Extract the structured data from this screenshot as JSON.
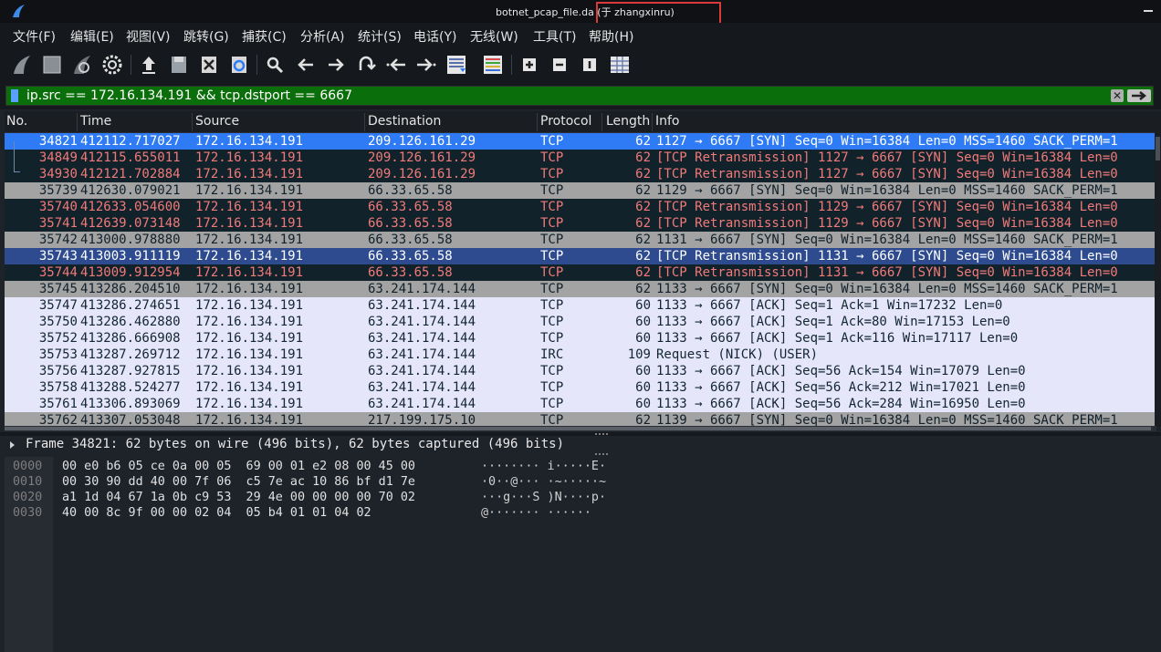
{
  "window": {
    "title": "botnet_pcap_file.da (于 zhangxinru)"
  },
  "menu": [
    "文件(F)",
    "编辑(E)",
    "视图(V)",
    "跳转(G)",
    "捕获(C)",
    "分析(A)",
    "统计(S)",
    "电话(Y)",
    "无线(W)",
    "工具(T)",
    "帮助(H)"
  ],
  "toolbar": {
    "icons": [
      "shark-fin-icon",
      "stop-icon",
      "restart-icon",
      "options-gear-icon",
      "open-file-icon",
      "save-file-icon",
      "close-file-icon",
      "reload-icon",
      "search-icon",
      "back-arrow-icon",
      "forward-arrow-icon",
      "jump-icon",
      "first-packet-icon",
      "last-packet-icon",
      "autoscroll-icon",
      "colorize-icon",
      "zoom-in-icon",
      "zoom-out-icon",
      "normal-size-icon",
      "resize-columns-icon"
    ]
  },
  "filter": {
    "value": "ip.src == 172.16.134.191 && tcp.dstport == 6667"
  },
  "columns": [
    "No.",
    "Time",
    "Source",
    "Destination",
    "Protocol",
    "Length",
    "Info"
  ],
  "packets": [
    {
      "no": "34821",
      "time": "412112.717027",
      "src": "172.16.134.191",
      "dst": "209.126.161.29",
      "proto": "TCP",
      "len": "62",
      "info": "1127 → 6667 [SYN] Seq=0 Win=16384 Len=0 MSS=1460 SACK_PERM=1",
      "style": "sel"
    },
    {
      "no": "34849",
      "time": "412115.655011",
      "src": "172.16.134.191",
      "dst": "209.126.161.29",
      "proto": "TCP",
      "len": "62",
      "info": "[TCP Retransmission] 1127 → 6667 [SYN] Seq=0 Win=16384 Len=0",
      "style": "dark"
    },
    {
      "no": "34930",
      "time": "412121.702884",
      "src": "172.16.134.191",
      "dst": "209.126.161.29",
      "proto": "TCP",
      "len": "62",
      "info": "[TCP Retransmission] 1127 → 6667 [SYN] Seq=0 Win=16384 Len=0",
      "style": "dark"
    },
    {
      "no": "35739",
      "time": "412630.079021",
      "src": "172.16.134.191",
      "dst": "66.33.65.58",
      "proto": "TCP",
      "len": "62",
      "info": "1129 → 6667 [SYN] Seq=0 Win=16384 Len=0 MSS=1460 SACK_PERM=1",
      "style": "gray"
    },
    {
      "no": "35740",
      "time": "412633.054600",
      "src": "172.16.134.191",
      "dst": "66.33.65.58",
      "proto": "TCP",
      "len": "62",
      "info": "[TCP Retransmission] 1129 → 6667 [SYN] Seq=0 Win=16384 Len=0",
      "style": "dark"
    },
    {
      "no": "35741",
      "time": "412639.073148",
      "src": "172.16.134.191",
      "dst": "66.33.65.58",
      "proto": "TCP",
      "len": "62",
      "info": "[TCP Retransmission] 1129 → 6667 [SYN] Seq=0 Win=16384 Len=0",
      "style": "dark"
    },
    {
      "no": "35742",
      "time": "413000.978880",
      "src": "172.16.134.191",
      "dst": "66.33.65.58",
      "proto": "TCP",
      "len": "62",
      "info": "1131 → 6667 [SYN] Seq=0 Win=16384 Len=0 MSS=1460 SACK_PERM=1",
      "style": "gray"
    },
    {
      "no": "35743",
      "time": "413003.911119",
      "src": "172.16.134.191",
      "dst": "66.33.65.58",
      "proto": "TCP",
      "len": "62",
      "info": "[TCP Retransmission] 1131 → 6667 [SYN] Seq=0 Win=16384 Len=0",
      "style": "selblue"
    },
    {
      "no": "35744",
      "time": "413009.912954",
      "src": "172.16.134.191",
      "dst": "66.33.65.58",
      "proto": "TCP",
      "len": "62",
      "info": "[TCP Retransmission] 1131 → 6667 [SYN] Seq=0 Win=16384 Len=0",
      "style": "dark"
    },
    {
      "no": "35745",
      "time": "413286.204510",
      "src": "172.16.134.191",
      "dst": "63.241.174.144",
      "proto": "TCP",
      "len": "62",
      "info": "1133 → 6667 [SYN] Seq=0 Win=16384 Len=0 MSS=1460 SACK_PERM=1",
      "style": "gray"
    },
    {
      "no": "35747",
      "time": "413286.274651",
      "src": "172.16.134.191",
      "dst": "63.241.174.144",
      "proto": "TCP",
      "len": "60",
      "info": "1133 → 6667 [ACK] Seq=1 Ack=1 Win=17232 Len=0",
      "style": "light"
    },
    {
      "no": "35750",
      "time": "413286.462880",
      "src": "172.16.134.191",
      "dst": "63.241.174.144",
      "proto": "TCP",
      "len": "60",
      "info": "1133 → 6667 [ACK] Seq=1 Ack=80 Win=17153 Len=0",
      "style": "light"
    },
    {
      "no": "35752",
      "time": "413286.666908",
      "src": "172.16.134.191",
      "dst": "63.241.174.144",
      "proto": "TCP",
      "len": "60",
      "info": "1133 → 6667 [ACK] Seq=1 Ack=116 Win=17117 Len=0",
      "style": "light"
    },
    {
      "no": "35753",
      "time": "413287.269712",
      "src": "172.16.134.191",
      "dst": "63.241.174.144",
      "proto": "IRC",
      "len": "109",
      "info": "Request (NICK) (USER)",
      "style": "light"
    },
    {
      "no": "35756",
      "time": "413287.927815",
      "src": "172.16.134.191",
      "dst": "63.241.174.144",
      "proto": "TCP",
      "len": "60",
      "info": "1133 → 6667 [ACK] Seq=56 Ack=154 Win=17079 Len=0",
      "style": "light"
    },
    {
      "no": "35758",
      "time": "413288.524277",
      "src": "172.16.134.191",
      "dst": "63.241.174.144",
      "proto": "TCP",
      "len": "60",
      "info": "1133 → 6667 [ACK] Seq=56 Ack=212 Win=17021 Len=0",
      "style": "light"
    },
    {
      "no": "35761",
      "time": "413306.893069",
      "src": "172.16.134.191",
      "dst": "63.241.174.144",
      "proto": "TCP",
      "len": "60",
      "info": "1133 → 6667 [ACK] Seq=56 Ack=284 Win=16950 Len=0",
      "style": "light"
    },
    {
      "no": "35762",
      "time": "413307.053048",
      "src": "172.16.134.191",
      "dst": "217.199.175.10",
      "proto": "TCP",
      "len": "62",
      "info": "1139 → 6667 [SYN] Seq=0 Win=16384 Len=0 MSS=1460 SACK_PERM=1",
      "style": "gray"
    }
  ],
  "detail": {
    "frame": "Frame 34821: 62 bytes on wire (496 bits), 62 bytes captured (496 bits)"
  },
  "bytes": [
    {
      "off": "0000",
      "hex": "00 e0 b6 05 ce 0a 00 05  69 00 01 e2 08 00 45 00",
      "ascii": "········ i·····E·"
    },
    {
      "off": "0010",
      "hex": "00 30 90 dd 40 00 7f 06  c5 7e ac 10 86 bf d1 7e",
      "ascii": "·0··@··· ·~·····~"
    },
    {
      "off": "0020",
      "hex": "a1 1d 04 67 1a 0b c9 53  29 4e 00 00 00 00 70 02",
      "ascii": "···g···S )N····p·"
    },
    {
      "off": "0030",
      "hex": "40 00 8c 9f 00 00 02 04  05 b4 01 01 04 02",
      "ascii": "@······· ······"
    }
  ],
  "colors": {
    "selected": "#2f7bf5",
    "filter_ok": "#0a6e0a",
    "retransmission_bg": "#12222a",
    "retransmission_fg": "#f07a7a",
    "syn_bg": "#a3a3a3",
    "ack_bg": "#e6e6fa"
  }
}
